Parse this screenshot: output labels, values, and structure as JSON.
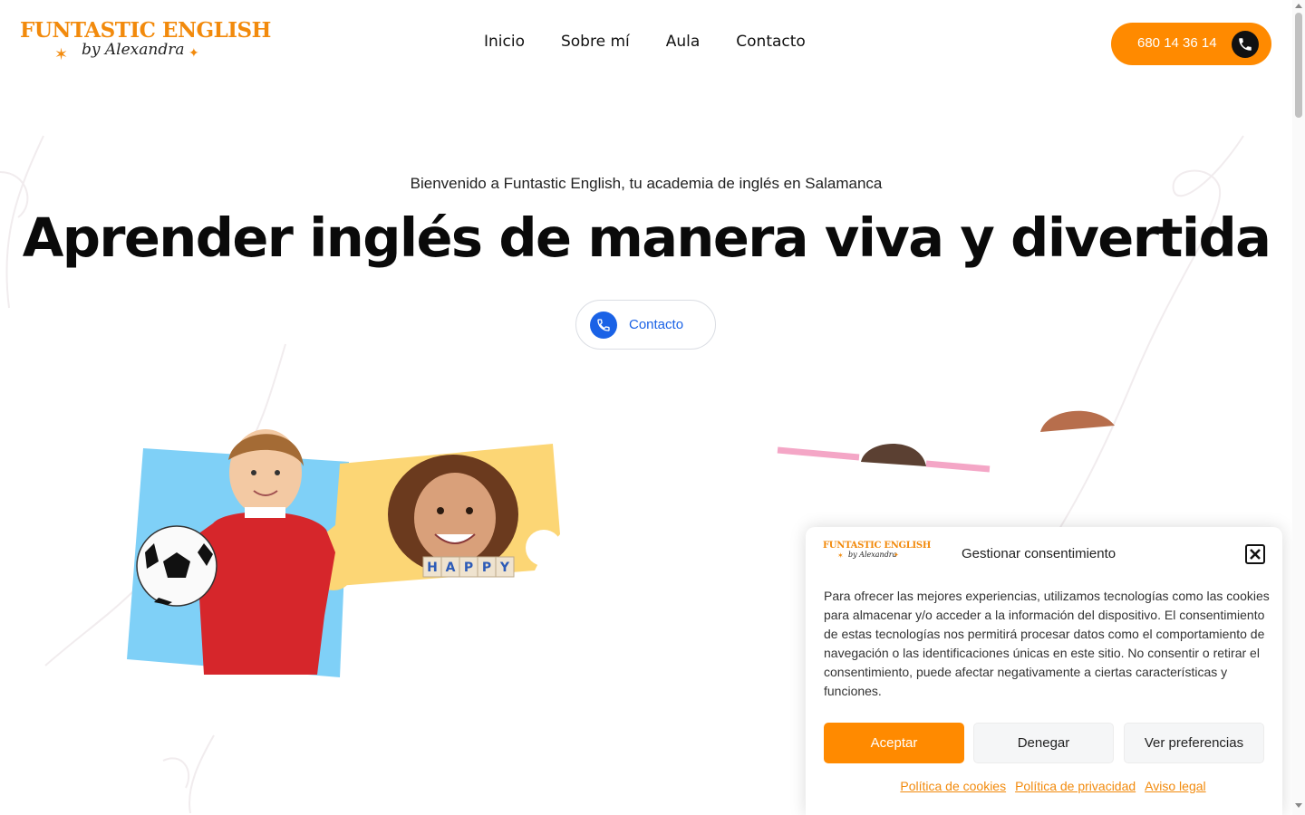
{
  "header": {
    "logo": {
      "main": "FUNTASTIC ENGLISH",
      "sub": "by Alexandra"
    },
    "nav": [
      "Inicio",
      "Sobre mí",
      "Aula",
      "Contacto"
    ],
    "phone": "680 14 36 14"
  },
  "hero": {
    "subtitle": "Bienvenido a Funtastic English, tu academia de inglés en Salamanca",
    "title": "Aprender inglés de manera viva y divertida",
    "contact_button": "Contacto"
  },
  "images": {
    "blocks_text": "HAPPY"
  },
  "cookie_dialog": {
    "logo": {
      "main": "FUNTASTIC ENGLISH",
      "sub": "by Alexandra"
    },
    "title": "Gestionar consentimiento",
    "body": "Para ofrecer las mejores experiencias, utilizamos tecnologías como las cookies para almacenar y/o acceder a la información del dispositivo. El consentimiento de estas tecnologías nos permitirá procesar datos como el comportamiento de navegación o las identificaciones únicas en este sitio. No consentir o retirar el consentimiento, puede afectar negativamente a ciertas características y funciones.",
    "buttons": {
      "accept": "Aceptar",
      "deny": "Denegar",
      "preferences": "Ver preferencias"
    },
    "links": [
      "Política de cookies",
      "Política de privacidad",
      "Aviso legal"
    ]
  },
  "colors": {
    "brand_orange": "#ff8a00",
    "link_blue": "#1a62e6",
    "panel_blue": "#7fd0f7",
    "panel_yellow": "#fcd675"
  },
  "icons": [
    "phone-icon",
    "close-icon",
    "star-icon"
  ]
}
